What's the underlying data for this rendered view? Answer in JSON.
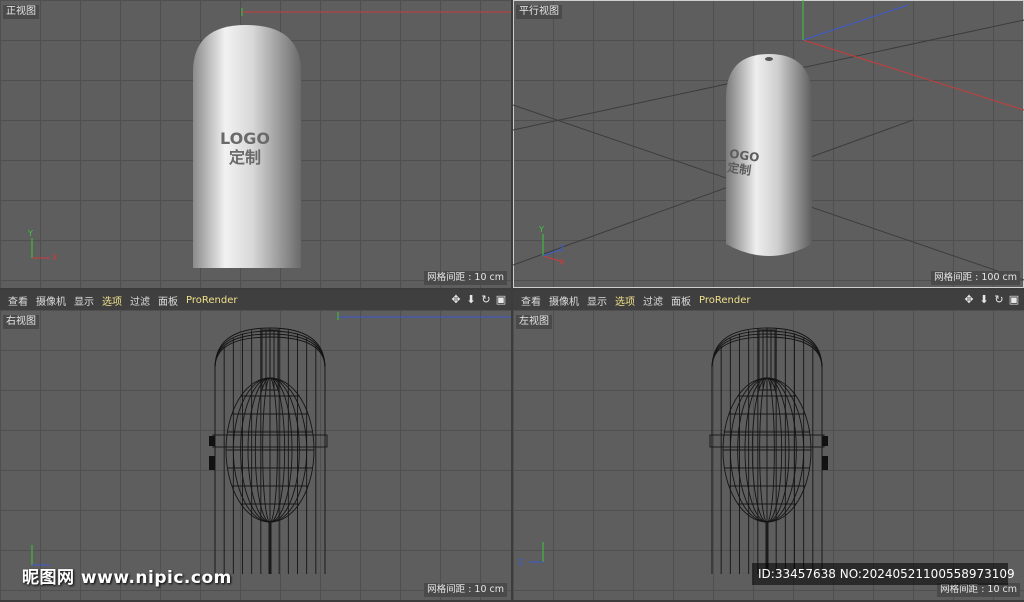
{
  "viewports": {
    "top_left": {
      "title": "正视图",
      "grid_spacing": "网格间距 : 10 cm",
      "logo_line1": "LOGO",
      "logo_line2": "定制"
    },
    "top_right": {
      "title": "平行视图",
      "grid_spacing": "网格间距 : 100 cm",
      "logo_line1": "OGO",
      "logo_line2": "定制"
    },
    "bottom_left": {
      "title": "右视图",
      "grid_spacing": "网格间距 : 10 cm"
    },
    "bottom_right": {
      "title": "左视图",
      "grid_spacing": "网格间距 : 10 cm"
    }
  },
  "menubar_left": {
    "items": [
      "查看",
      "摄像机",
      "显示",
      "选项",
      "过滤",
      "面板",
      "ProRender"
    ]
  },
  "menubar_right": {
    "items": [
      "查看",
      "摄像机",
      "显示",
      "选项",
      "过滤",
      "面板",
      "ProRender"
    ]
  },
  "toolbar_icons": [
    "move-icon",
    "arrow-down-icon",
    "rotate-icon",
    "maximize-icon"
  ],
  "axis_labels": {
    "y": "Y",
    "x": "X",
    "z": "Z"
  },
  "watermark": {
    "left": "昵图网 www.nipic.com",
    "right": "ID:33457638 NO:20240521100558973109"
  },
  "colors": {
    "viewport_bg": "#5e5e5e",
    "grid": "#4f4f4f",
    "accent_menu": "#f0e08a",
    "axis_x": "#c83c3c",
    "axis_y": "#3cc83c",
    "axis_z": "#3c5ad2"
  }
}
